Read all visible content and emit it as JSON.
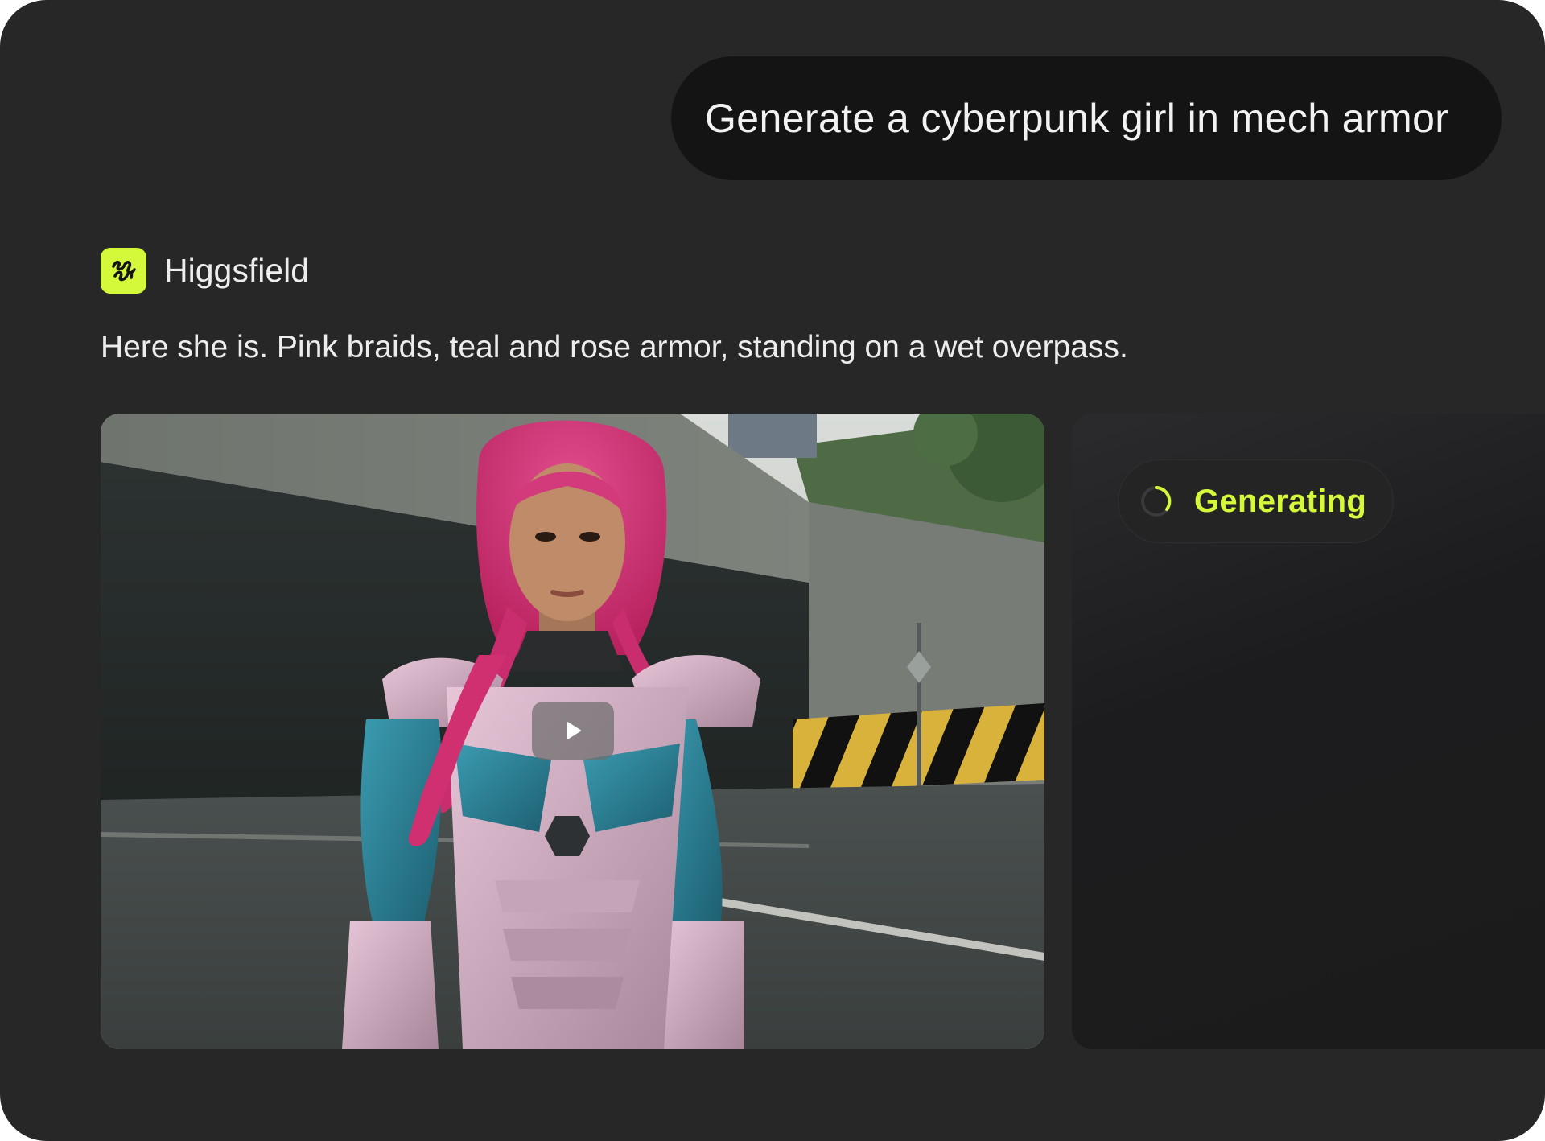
{
  "user_message": {
    "text": "Generate a cyberpunk girl in mech armor"
  },
  "assistant": {
    "name": "Higgsfield",
    "logo_icon": "higgsfield-squiggle-icon",
    "message": "Here she is. Pink braids, teal and rose armor, standing on a wet overpass."
  },
  "media": {
    "kind": "video",
    "play_icon": "play-icon"
  },
  "pending_generation": {
    "status_label": "Generating",
    "spinner_icon": "loading-spinner-icon"
  },
  "colors": {
    "background": "#272727",
    "user_bubble": "#141414",
    "accent": "#d4f83a",
    "text": "#ededed"
  }
}
